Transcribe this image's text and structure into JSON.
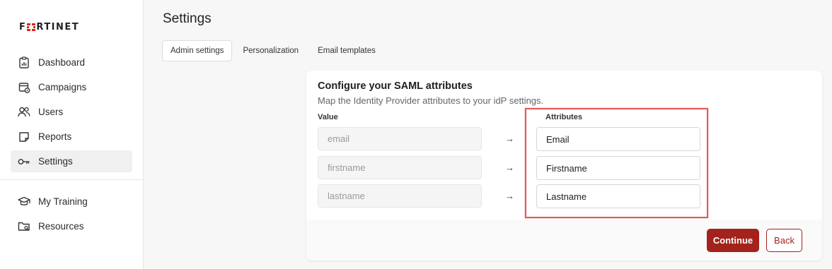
{
  "brand": {
    "logo_text": "FRTINET",
    "accent": "#a3231c",
    "logo_red": "#da291c"
  },
  "sidebar": {
    "items": [
      {
        "label": "Dashboard",
        "icon": "clipboard-chart-icon"
      },
      {
        "label": "Campaigns",
        "icon": "calendar-gear-icon"
      },
      {
        "label": "Users",
        "icon": "users-icon"
      },
      {
        "label": "Reports",
        "icon": "note-icon"
      },
      {
        "label": "Settings",
        "icon": "key-icon",
        "active": true
      }
    ],
    "secondary_items": [
      {
        "label": "My Training",
        "icon": "graduation-cap-icon"
      },
      {
        "label": "Resources",
        "icon": "folder-search-icon"
      }
    ]
  },
  "main": {
    "title": "Settings",
    "tabs": [
      {
        "label": "Admin settings",
        "active": true
      },
      {
        "label": "Personalization"
      },
      {
        "label": "Email templates"
      }
    ]
  },
  "saml": {
    "title": "Configure your SAML attributes",
    "subtitle": "Map the Identity Provider attributes to your idP settings.",
    "value_header": "Value",
    "attributes_header": "Attributes",
    "arrow_glyph": "→",
    "rows": [
      {
        "value": "email",
        "attribute": "Email"
      },
      {
        "value": "firstname",
        "attribute": "Firstname"
      },
      {
        "value": "lastname",
        "attribute": "Lastname"
      }
    ],
    "continue_label": "Continue",
    "back_label": "Back"
  }
}
